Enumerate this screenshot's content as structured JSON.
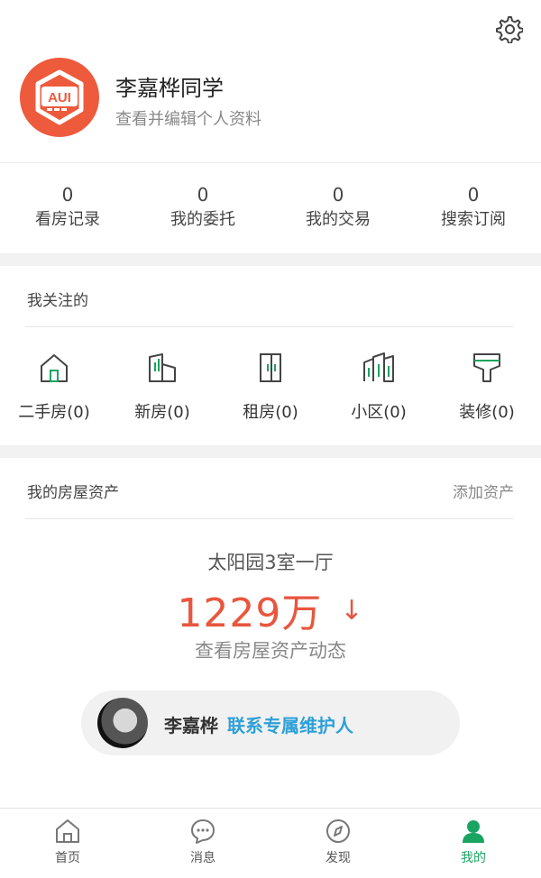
{
  "header": {
    "settings_icon": "gear-icon"
  },
  "profile": {
    "logo_text": "AUI",
    "name": "李嘉桦同学",
    "subtitle": "查看并编辑个人资料",
    "logo_color": "#ee5a3c"
  },
  "stats": [
    {
      "count": "0",
      "label": "看房记录"
    },
    {
      "count": "0",
      "label": "我的委托"
    },
    {
      "count": "0",
      "label": "我的交易"
    },
    {
      "count": "0",
      "label": "搜索订阅"
    }
  ],
  "following": {
    "title": "我关注的",
    "items": [
      {
        "label": "二手房(0)",
        "icon": "house-icon"
      },
      {
        "label": "新房(0)",
        "icon": "building-icon"
      },
      {
        "label": "租房(0)",
        "icon": "door-icon"
      },
      {
        "label": "小区(0)",
        "icon": "community-icon"
      },
      {
        "label": "装修(0)",
        "icon": "paint-brush-icon"
      }
    ],
    "icon_color": "#1aa461"
  },
  "assets": {
    "title": "我的房屋资产",
    "add_label": "添加资产",
    "property_name": "太阳园3室一厅",
    "price": "1229万",
    "trend_symbol": "↓",
    "trend_icon": "down-arrow-icon",
    "price_color": "#e8563e",
    "view_link": "查看房屋资产动态"
  },
  "agent": {
    "name": "李嘉桦",
    "contact_label": "联系专属维护人",
    "contact_color": "#2ea0d8"
  },
  "tabbar": {
    "active_color": "#1aa461",
    "tabs": [
      {
        "label": "首页",
        "icon": "home-icon"
      },
      {
        "label": "消息",
        "icon": "message-icon"
      },
      {
        "label": "发现",
        "icon": "compass-icon"
      },
      {
        "label": "我的",
        "icon": "user-icon",
        "active": true
      }
    ]
  }
}
